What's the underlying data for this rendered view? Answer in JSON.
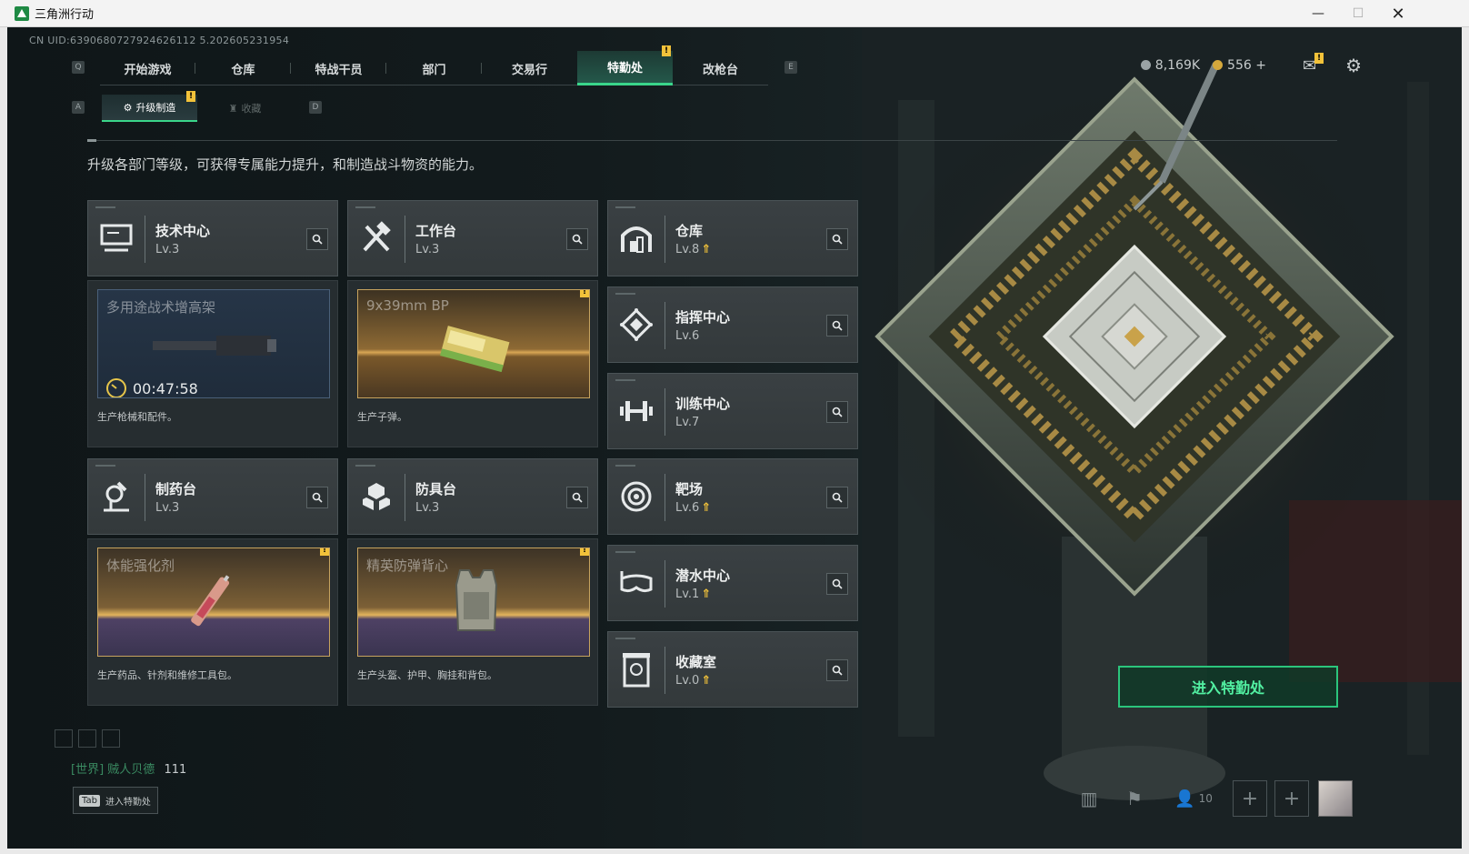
{
  "window": {
    "title": "三角洲行动"
  },
  "uid": "CN UID:6390680727924626112 5.202605231954",
  "nav": {
    "keys": {
      "left": "Q",
      "right": "E"
    },
    "tabs": [
      "开始游戏",
      "仓库",
      "特战干员",
      "部门",
      "交易行",
      "特勤处",
      "改枪台"
    ],
    "active": 5
  },
  "subnav": {
    "keys": {
      "left": "A",
      "right": "D"
    },
    "tabs": [
      "升级制造",
      "收藏"
    ],
    "active": 0
  },
  "header": {
    "currency1": "8,169K",
    "currency2": "556",
    "plus": "+"
  },
  "description": "升级各部门等级，可获得专属能力提升，和制造战斗物资的能力。",
  "departments": [
    {
      "name": "技术中心",
      "level": "Lv.3",
      "up": false,
      "icon": "computer-icon"
    },
    {
      "name": "工作台",
      "level": "Lv.3",
      "up": false,
      "icon": "tools-icon"
    },
    {
      "name": "仓库",
      "level": "Lv.8",
      "up": true,
      "icon": "warehouse-icon"
    },
    {
      "name": "指挥中心",
      "level": "Lv.6",
      "up": false,
      "icon": "command-icon"
    },
    {
      "name": "训练中心",
      "level": "Lv.7",
      "up": false,
      "icon": "dumbbell-icon"
    },
    {
      "name": "制药台",
      "level": "Lv.3",
      "up": false,
      "icon": "microscope-icon"
    },
    {
      "name": "防具台",
      "level": "Lv.3",
      "up": false,
      "icon": "armor-icon"
    },
    {
      "name": "靶场",
      "level": "Lv.6",
      "up": true,
      "icon": "target-icon"
    },
    {
      "name": "潜水中心",
      "level": "Lv.1",
      "up": true,
      "icon": "goggles-icon"
    },
    {
      "name": "收藏室",
      "level": "Lv.0",
      "up": true,
      "icon": "collection-icon"
    }
  ],
  "productions": [
    {
      "item": "多用途战术增高架",
      "desc": "生产枪械和配件。",
      "timer": "00:47:58"
    },
    {
      "item": "9x39mm BP",
      "desc": "生产子弹。"
    },
    {
      "item": "体能强化剂",
      "desc": "生产药品、针剂和维修工具包。"
    },
    {
      "item": "精英防弹背心",
      "desc": "生产头盔、护甲、胸挂和背包。"
    }
  ],
  "chat": {
    "channel": "[世界]",
    "name": "贼人贝德",
    "message": "111"
  },
  "tabhint": {
    "key": "Tab",
    "label": "进入特勤处"
  },
  "enter_button": "进入特勤处",
  "friends_count": "10",
  "colors": {
    "accent": "#3ad58a",
    "badge": "#f2c23a"
  }
}
